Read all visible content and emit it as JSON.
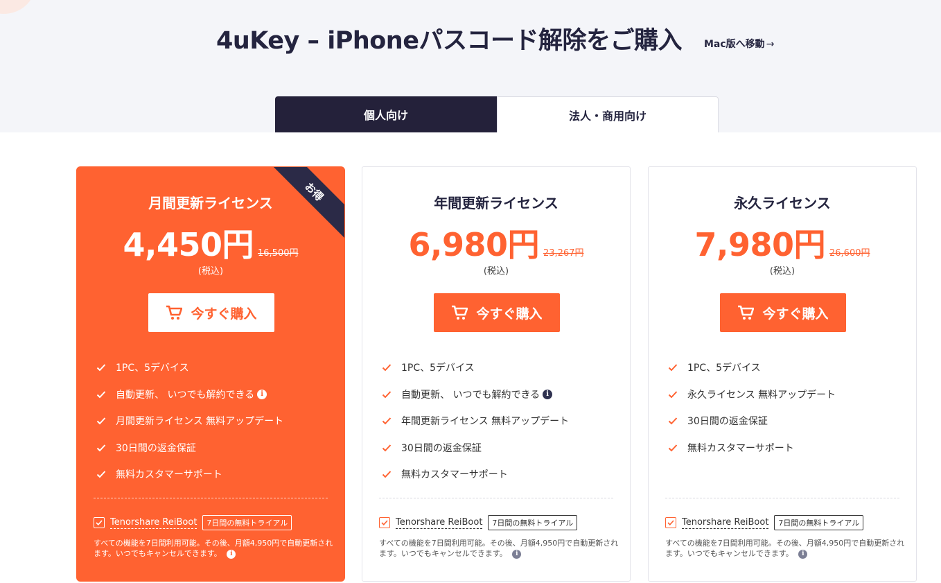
{
  "header": {
    "title": "4uKey – iPhoneパスコード解除をご購入",
    "mac_link": "Mac版へ移動",
    "mac_link_arrow": "→"
  },
  "tabs": [
    {
      "label": "個人向け",
      "active": true
    },
    {
      "label": "法人・商用向け",
      "active": false
    }
  ],
  "colors": {
    "accent": "#ff6231",
    "dark": "#24213a"
  },
  "plans": [
    {
      "title": "月間更新ライセンス",
      "price": "4,450円",
      "original_price": "16,500円",
      "tax_note": "(税込)",
      "badge": "お得",
      "buy_label": "今すぐ購入",
      "features": [
        "1PC、5デバイス",
        "自動更新、 いつでも解約できる",
        "月間更新ライセンス 無料アップデート",
        "30日間の返金保証",
        "無料カスタマーサポート"
      ],
      "addon_name": "Tenorshare ReiBoot",
      "addon_badge": "7日間の無料トライアル",
      "addon_note": "すべての機能を7日間利用可能。その後、月額4,950円で自動更新されます。いつでもキャンセルできます。"
    },
    {
      "title": "年間更新ライセンス",
      "price": "6,980円",
      "original_price": "23,267円",
      "tax_note": "(税込)",
      "buy_label": "今すぐ購入",
      "features": [
        "1PC、5デバイス",
        "自動更新、 いつでも解約できる",
        "年間更新ライセンス 無料アップデート",
        "30日間の返金保証",
        "無料カスタマーサポート"
      ],
      "addon_name": "Tenorshare ReiBoot",
      "addon_badge": "7日間の無料トライアル",
      "addon_note": "すべての機能を7日間利用可能。その後、月額4,950円で自動更新されます。いつでもキャンセルできます。"
    },
    {
      "title": "永久ライセンス",
      "price": "7,980円",
      "original_price": "26,600円",
      "tax_note": "(税込)",
      "buy_label": "今すぐ購入",
      "features": [
        "1PC、5デバイス",
        "永久ライセンス 無料アップデート",
        "30日間の返金保証",
        "無料カスタマーサポート"
      ],
      "addon_name": "Tenorshare ReiBoot",
      "addon_badge": "7日間の無料トライアル",
      "addon_note": "すべての機能を7日間利用可能。その後、月額4,950円で自動更新されます。いつでもキャンセルできます。"
    }
  ]
}
